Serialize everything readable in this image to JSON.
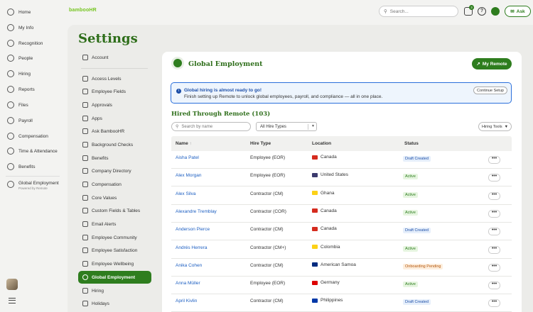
{
  "app": {
    "logo": "bambooHR"
  },
  "leftnav": {
    "items": [
      {
        "label": "Home",
        "icon": "home-icon"
      },
      {
        "label": "My Info",
        "icon": "person-icon"
      },
      {
        "label": "Recognition",
        "icon": "award-icon"
      },
      {
        "label": "People",
        "icon": "people-icon"
      },
      {
        "label": "Hiring",
        "icon": "briefcase-icon"
      },
      {
        "label": "Reports",
        "icon": "chart-icon"
      },
      {
        "label": "Files",
        "icon": "file-icon"
      },
      {
        "label": "Payroll",
        "icon": "payroll-icon"
      },
      {
        "label": "Compensation",
        "icon": "compensation-icon"
      },
      {
        "label": "Time & Attendance",
        "icon": "clock-icon"
      },
      {
        "label": "Benefits",
        "icon": "benefits-icon"
      }
    ],
    "global_employment": {
      "label": "Global Employment",
      "sub": "Powered by Remote"
    }
  },
  "topbar": {
    "search_placeholder": "Search...",
    "notification_count": "3",
    "ask_label": "Ask"
  },
  "settings": {
    "title": "Settings",
    "nav": [
      {
        "label": "Account"
      },
      {
        "label": "Access Levels"
      },
      {
        "label": "Employee Fields"
      },
      {
        "label": "Approvals"
      },
      {
        "label": "Apps"
      },
      {
        "label": "Ask BambooHR"
      },
      {
        "label": "Background Checks"
      },
      {
        "label": "Benefits"
      },
      {
        "label": "Company Directory"
      },
      {
        "label": "Compensation"
      },
      {
        "label": "Core Values"
      },
      {
        "label": "Custom Fields & Tables"
      },
      {
        "label": "Email Alerts"
      },
      {
        "label": "Employee Community"
      },
      {
        "label": "Employee Satisfaction"
      },
      {
        "label": "Employee Wellbeing"
      },
      {
        "label": "Global Employment",
        "active": true
      },
      {
        "label": "Hiring"
      },
      {
        "label": "Holidays"
      }
    ]
  },
  "content": {
    "title": "Global Employment",
    "my_remote_label": "My Remote",
    "banner": {
      "title": "Global hiring is almost ready to go!",
      "text": "Finish setting up Remote to unlock global employees, payroll, and compliance — all in one place.",
      "button": "Continue Setup"
    },
    "section_title": "Hired Through Remote (103)",
    "search_placeholder": "Search by name",
    "hire_type_select": "All Hire Types",
    "hiring_tools_label": "Hiring Tools",
    "columns": {
      "name": "Name",
      "hire_type": "Hire Type",
      "location": "Location",
      "status": "Status"
    },
    "rows": [
      {
        "name": "Aisha Patel",
        "hire_type": "Employee (EOR)",
        "location": "Canada",
        "flag": "#d52b1e",
        "status": "Draft Created",
        "status_kind": "draft"
      },
      {
        "name": "Alex Morgan",
        "hire_type": "Employee (EOR)",
        "location": "United States",
        "flag": "#3c3b6e",
        "status": "Active",
        "status_kind": "active"
      },
      {
        "name": "Alex Silva",
        "hire_type": "Contractor (CM)",
        "location": "Ghana",
        "flag": "#fcd116",
        "status": "Active",
        "status_kind": "active"
      },
      {
        "name": "Alexandre Tremblay",
        "hire_type": "Contractor (COR)",
        "location": "Canada",
        "flag": "#d52b1e",
        "status": "Active",
        "status_kind": "active"
      },
      {
        "name": "Anderson Pierce",
        "hire_type": "Contractor (CM)",
        "location": "Canada",
        "flag": "#d52b1e",
        "status": "Draft Created",
        "status_kind": "draft"
      },
      {
        "name": "Andrés Herrera",
        "hire_type": "Contractor (CM+)",
        "location": "Colombia",
        "flag": "#fcd116",
        "status": "Active",
        "status_kind": "active"
      },
      {
        "name": "Anika Cohen",
        "hire_type": "Contractor (CM)",
        "location": "American Samoa",
        "flag": "#002b7f",
        "status": "Onboarding Pending",
        "status_kind": "pending"
      },
      {
        "name": "Anna Müller",
        "hire_type": "Employee (EOR)",
        "location": "Germany",
        "flag": "#dd0000",
        "status": "Active",
        "status_kind": "active"
      },
      {
        "name": "April Kivlin",
        "hire_type": "Contractor (CM)",
        "location": "Philippines",
        "flag": "#0038a8",
        "status": "Draft Created",
        "status_kind": "draft"
      }
    ],
    "more_label": "•••"
  },
  "colors": {
    "brand_green": "#2e7d1e",
    "link_blue": "#1d5fc2",
    "logo_green": "#73c41d"
  }
}
